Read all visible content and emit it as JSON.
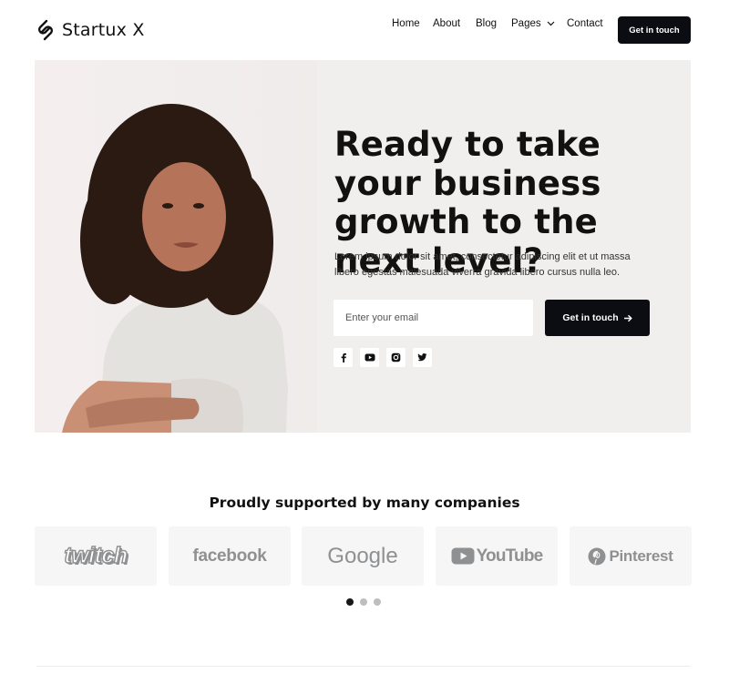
{
  "brand": {
    "name": "Startux X"
  },
  "nav": {
    "items": [
      "Home",
      "About",
      "Blog",
      "Pages",
      "Contact"
    ],
    "cta": "Get in touch"
  },
  "hero": {
    "title": "Ready to take your business growth to the next level?",
    "description": "Lorem ipsum dolor sit amet, consectetur adipiscing elit et ut massa libero egestas malesuada viverra gravida libero cursus nulla leo.",
    "email_placeholder": "Enter your email",
    "cta": "Get in touch",
    "socials": [
      "facebook-icon",
      "youtube-icon",
      "instagram-icon",
      "twitter-icon"
    ]
  },
  "companies": {
    "title": "Proudly supported by many companies",
    "logos": [
      "twitch",
      "facebook",
      "Google",
      "YouTube",
      "Pinterest"
    ],
    "carousel": {
      "pages": 3,
      "active_index": 0
    }
  },
  "colors": {
    "accent": "#0b0d12",
    "hero_bg": "#f1efed",
    "logo_gray": "#8f9092"
  }
}
